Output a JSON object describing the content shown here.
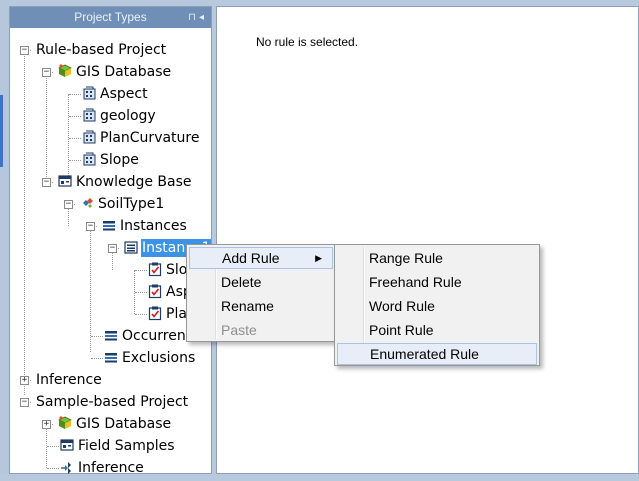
{
  "panel": {
    "title": "Project Types",
    "pin_glyph": "⊓",
    "close_glyph": "◂"
  },
  "tree": [
    {
      "label": "Rule-based Project",
      "icon": "none"
    },
    {
      "label": "GIS Database",
      "icon": "gis-database-icon"
    },
    {
      "label": "Aspect",
      "icon": "raster-layer-icon"
    },
    {
      "label": "geology",
      "icon": "raster-layer-icon"
    },
    {
      "label": "PlanCurvature",
      "icon": "raster-layer-icon"
    },
    {
      "label": "Slope",
      "icon": "raster-layer-icon"
    },
    {
      "label": "Knowledge Base",
      "icon": "knowledge-base-icon"
    },
    {
      "label": "SoilType1",
      "icon": "soil-type-icon"
    },
    {
      "label": "Instances",
      "icon": "instances-icon"
    },
    {
      "label": "Instance1",
      "icon": "instance-icon"
    },
    {
      "label": "Slo",
      "icon": "rule-icon"
    },
    {
      "label": "Asp",
      "icon": "rule-icon"
    },
    {
      "label": "Pla",
      "icon": "rule-icon"
    },
    {
      "label": "Occurrence",
      "icon": "occurrences-icon"
    },
    {
      "label": "Exclusions",
      "icon": "exclusions-icon"
    },
    {
      "label": "Inference",
      "icon": "none"
    },
    {
      "label": "Sample-based Project",
      "icon": "none"
    },
    {
      "label": "GIS Database",
      "icon": "gis-database-icon"
    },
    {
      "label": "Field Samples",
      "icon": "field-samples-icon"
    },
    {
      "label": "Inference",
      "icon": "inference-icon"
    }
  ],
  "main": {
    "message": "No rule is selected."
  },
  "context_menu": {
    "items": [
      {
        "label": "Add Rule",
        "enabled": true,
        "has_submenu": true
      },
      {
        "label": "Delete",
        "enabled": true
      },
      {
        "label": "Rename",
        "enabled": true
      },
      {
        "label": "Paste",
        "enabled": false
      }
    ],
    "submenu_arrow": "▶"
  },
  "submenu": {
    "items": [
      {
        "label": "Range Rule"
      },
      {
        "label": "Freehand Rule"
      },
      {
        "label": "Word Rule"
      },
      {
        "label": "Point Rule"
      },
      {
        "label": "Enumerated Rule",
        "highlighted": true
      }
    ]
  },
  "colors": {
    "selection": "#3c93e6",
    "panel_header": "#6f8fb7",
    "menu_bg": "#f1f1f1",
    "menu_hover": "#e8eef7"
  }
}
